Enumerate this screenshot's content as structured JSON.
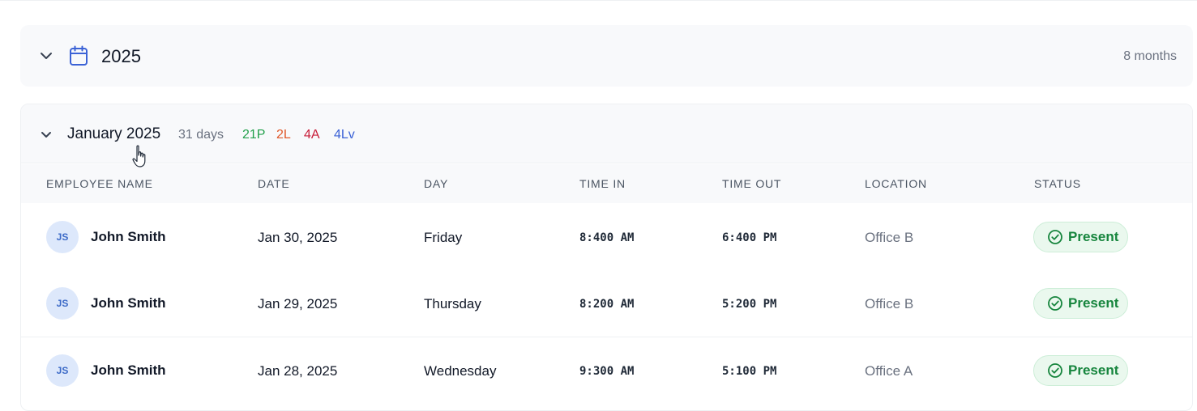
{
  "year_section": {
    "year": "2025",
    "count": "8 months",
    "icons": {
      "toggle": "chevron-down-icon",
      "calendar": "calendar-icon"
    }
  },
  "month_section": {
    "title": "January 2025",
    "days": "31 days",
    "stats": {
      "present": "21P",
      "late": "2L",
      "absent": "4A",
      "leave": "4Lv"
    },
    "colors": {
      "present": "#22a04b",
      "late": "#e0582a",
      "absent": "#c81e3a",
      "leave": "#3b62d6"
    }
  },
  "table": {
    "headers": [
      "EMPLOYEE NAME",
      "DATE",
      "DAY",
      "TIME IN",
      "TIME OUT",
      "LOCATION",
      "STATUS"
    ],
    "rows": [
      {
        "initials": "JS",
        "name": "John Smith",
        "date": "Jan 30, 2025",
        "day": "Friday",
        "time_in": "8:400 AM",
        "time_out": "6:400 PM",
        "location": "Office B",
        "status": "Present"
      },
      {
        "initials": "JS",
        "name": "John Smith",
        "date": "Jan 29, 2025",
        "day": "Thursday",
        "time_in": "8:200 AM",
        "time_out": "5:200 PM",
        "location": "Office B",
        "status": "Present"
      },
      {
        "initials": "JS",
        "name": "John Smith",
        "date": "Jan 28, 2025",
        "day": "Wednesday",
        "time_in": "9:300 AM",
        "time_out": "5:100 PM",
        "location": "Office A",
        "status": "Present"
      }
    ]
  },
  "status_icon": "check-circle-icon"
}
